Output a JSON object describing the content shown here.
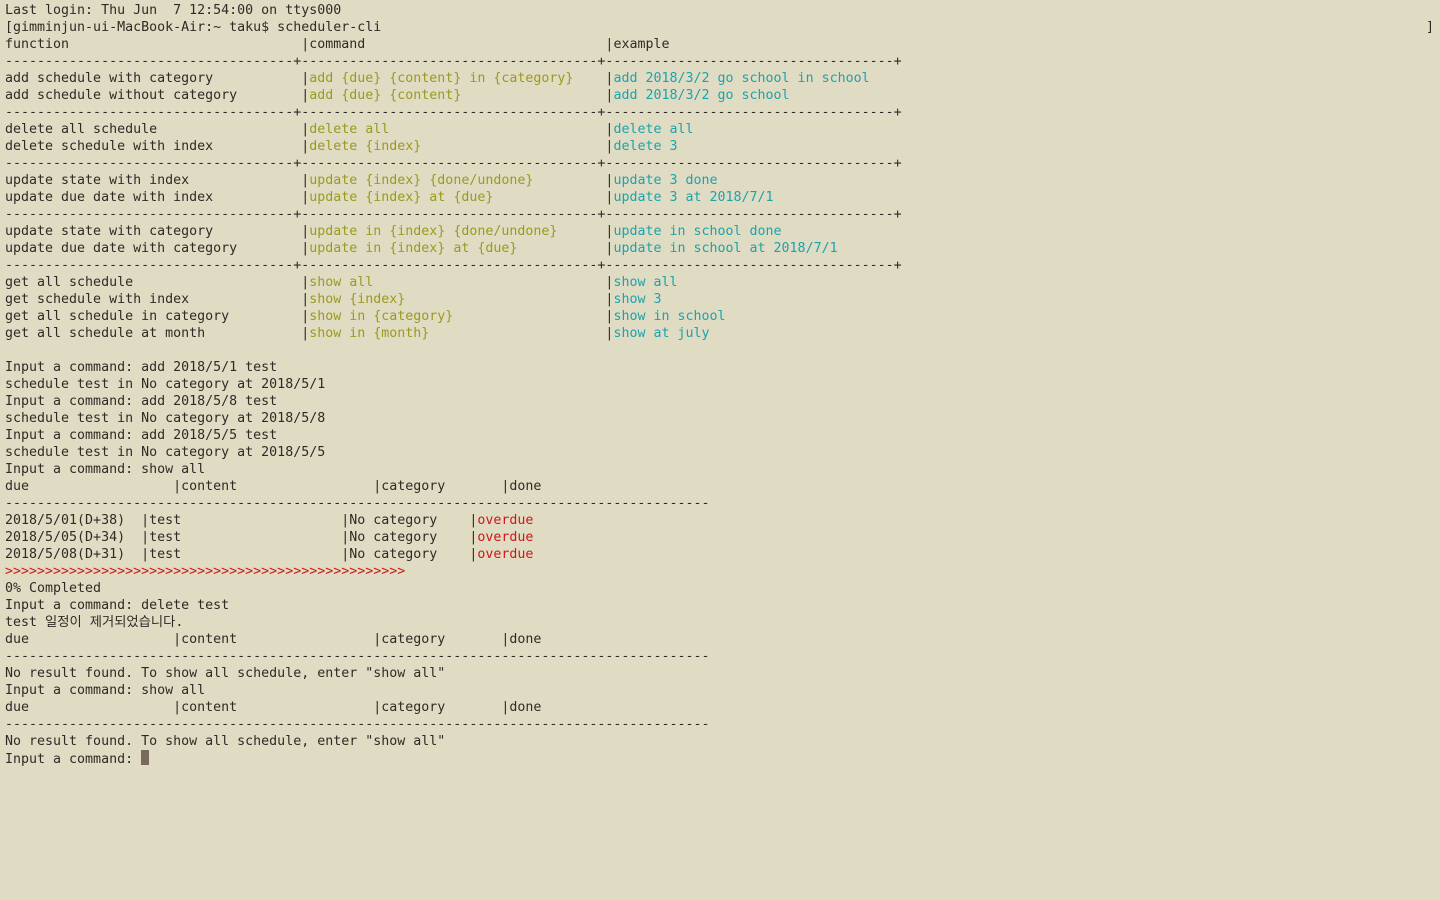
{
  "window": {
    "right_marker": "]",
    "cursor_icon": "block-cursor-icon"
  },
  "colors": {
    "background": "#e0dcc4",
    "text": "#2e2a26",
    "command": "#9b9a1c",
    "example": "#1aa3ad",
    "overdue": "#d01616",
    "cursor": "#7a6a5e"
  },
  "lines": [
    {
      "segs": [
        {
          "t": "Last login: Thu Jun  7 12:54:00 on ttys000",
          "c": "plain"
        }
      ]
    },
    {
      "segs": [
        {
          "t": "[gimminjun-ui-MacBook-Air:~ taku$ scheduler-cli",
          "c": "plain"
        }
      ]
    },
    {
      "segs": [
        {
          "t": "function                             |",
          "c": "fn"
        },
        {
          "t": "command",
          "c": "plain"
        },
        {
          "t": "                              |",
          "c": "pipe"
        },
        {
          "t": "example",
          "c": "plain"
        }
      ]
    },
    {
      "segs": [
        {
          "t": "------------------------------------+-------------------------------------+------------------------------------+",
          "c": "plain"
        }
      ]
    },
    {
      "segs": [
        {
          "t": "add schedule with category           |",
          "c": "fn"
        },
        {
          "t": "add {due} {content} in {category}",
          "c": "cmd"
        },
        {
          "t": "    |",
          "c": "pipe"
        },
        {
          "t": "add 2018/3/2 go school in school",
          "c": "ex"
        }
      ]
    },
    {
      "segs": [
        {
          "t": "add schedule without category        |",
          "c": "fn"
        },
        {
          "t": "add {due} {content}",
          "c": "cmd"
        },
        {
          "t": "                  |",
          "c": "pipe"
        },
        {
          "t": "add 2018/3/2 go school",
          "c": "ex"
        }
      ]
    },
    {
      "segs": [
        {
          "t": "------------------------------------+-------------------------------------+------------------------------------+",
          "c": "plain"
        }
      ]
    },
    {
      "segs": [
        {
          "t": "delete all schedule                  |",
          "c": "fn"
        },
        {
          "t": "delete all",
          "c": "cmd"
        },
        {
          "t": "                           |",
          "c": "pipe"
        },
        {
          "t": "delete all",
          "c": "ex"
        }
      ]
    },
    {
      "segs": [
        {
          "t": "delete schedule with index           |",
          "c": "fn"
        },
        {
          "t": "delete {index}",
          "c": "cmd"
        },
        {
          "t": "                       |",
          "c": "pipe"
        },
        {
          "t": "delete 3",
          "c": "ex"
        }
      ]
    },
    {
      "segs": [
        {
          "t": "------------------------------------+-------------------------------------+------------------------------------+",
          "c": "plain"
        }
      ]
    },
    {
      "segs": [
        {
          "t": "update state with index              |",
          "c": "fn"
        },
        {
          "t": "update {index} {done/undone}",
          "c": "cmd"
        },
        {
          "t": "         |",
          "c": "pipe"
        },
        {
          "t": "update 3 done",
          "c": "ex"
        }
      ]
    },
    {
      "segs": [
        {
          "t": "update due date with index           |",
          "c": "fn"
        },
        {
          "t": "update {index} at {due}",
          "c": "cmd"
        },
        {
          "t": "              |",
          "c": "pipe"
        },
        {
          "t": "update 3 at 2018/7/1",
          "c": "ex"
        }
      ]
    },
    {
      "segs": [
        {
          "t": "------------------------------------+-------------------------------------+------------------------------------+",
          "c": "plain"
        }
      ]
    },
    {
      "segs": [
        {
          "t": "update state with category           |",
          "c": "fn"
        },
        {
          "t": "update in {index} {done/undone}",
          "c": "cmd"
        },
        {
          "t": "      |",
          "c": "pipe"
        },
        {
          "t": "update in school done",
          "c": "ex"
        }
      ]
    },
    {
      "segs": [
        {
          "t": "update due date with category        |",
          "c": "fn"
        },
        {
          "t": "update in {index} at {due}",
          "c": "cmd"
        },
        {
          "t": "           |",
          "c": "pipe"
        },
        {
          "t": "update in school at 2018/7/1",
          "c": "ex"
        }
      ]
    },
    {
      "segs": [
        {
          "t": "------------------------------------+-------------------------------------+------------------------------------+",
          "c": "plain"
        }
      ]
    },
    {
      "segs": [
        {
          "t": "get all schedule                     |",
          "c": "fn"
        },
        {
          "t": "show all",
          "c": "cmd"
        },
        {
          "t": "                             |",
          "c": "pipe"
        },
        {
          "t": "show all",
          "c": "ex"
        }
      ]
    },
    {
      "segs": [
        {
          "t": "get schedule with index              |",
          "c": "fn"
        },
        {
          "t": "show {index}",
          "c": "cmd"
        },
        {
          "t": "                         |",
          "c": "pipe"
        },
        {
          "t": "show 3",
          "c": "ex"
        }
      ]
    },
    {
      "segs": [
        {
          "t": "get all schedule in category         |",
          "c": "fn"
        },
        {
          "t": "show in {category}",
          "c": "cmd"
        },
        {
          "t": "                   |",
          "c": "pipe"
        },
        {
          "t": "show in school",
          "c": "ex"
        }
      ]
    },
    {
      "segs": [
        {
          "t": "get all schedule at month            |",
          "c": "fn"
        },
        {
          "t": "show in {month}",
          "c": "cmd"
        },
        {
          "t": "                      |",
          "c": "pipe"
        },
        {
          "t": "show at july",
          "c": "ex"
        }
      ]
    },
    {
      "segs": [
        {
          "t": " ",
          "c": "plain"
        }
      ]
    },
    {
      "segs": [
        {
          "t": "Input a command: add 2018/5/1 test",
          "c": "plain"
        }
      ]
    },
    {
      "segs": [
        {
          "t": "schedule test in No category at 2018/5/1",
          "c": "plain"
        }
      ]
    },
    {
      "segs": [
        {
          "t": "Input a command: add 2018/5/8 test",
          "c": "plain"
        }
      ]
    },
    {
      "segs": [
        {
          "t": "schedule test in No category at 2018/5/8",
          "c": "plain"
        }
      ]
    },
    {
      "segs": [
        {
          "t": "Input a command: add 2018/5/5 test",
          "c": "plain"
        }
      ]
    },
    {
      "segs": [
        {
          "t": "schedule test in No category at 2018/5/5",
          "c": "plain"
        }
      ]
    },
    {
      "segs": [
        {
          "t": "Input a command: show all",
          "c": "plain"
        }
      ]
    },
    {
      "segs": [
        {
          "t": "due                  |content                 |category       |done",
          "c": "plain"
        }
      ]
    },
    {
      "segs": [
        {
          "t": "----------------------------------------------------------------------------------------",
          "c": "plain"
        }
      ]
    },
    {
      "segs": [
        {
          "t": "2018/5/01(D+38)  |test                    |No category    |",
          "c": "plain"
        },
        {
          "t": "overdue",
          "c": "red"
        }
      ]
    },
    {
      "segs": [
        {
          "t": "2018/5/05(D+34)  |test                    |No category    |",
          "c": "plain"
        },
        {
          "t": "overdue",
          "c": "red"
        }
      ]
    },
    {
      "segs": [
        {
          "t": "2018/5/08(D+31)  |test                    |No category    |",
          "c": "plain"
        },
        {
          "t": "overdue",
          "c": "red"
        }
      ]
    },
    {
      "segs": [
        {
          "t": ">>>>>>>>>>>>>>>>>>>>>>>>>>>>>>>>>>>>>>>>>>>>>>>>>>",
          "c": "red"
        }
      ]
    },
    {
      "segs": [
        {
          "t": "0% Completed",
          "c": "plain"
        }
      ]
    },
    {
      "segs": [
        {
          "t": "Input a command: delete test",
          "c": "plain"
        }
      ]
    },
    {
      "segs": [
        {
          "t": "test 일정이 제거되었습니다.",
          "c": "plain"
        }
      ]
    },
    {
      "segs": [
        {
          "t": "due                  |content                 |category       |done",
          "c": "plain"
        }
      ]
    },
    {
      "segs": [
        {
          "t": "----------------------------------------------------------------------------------------",
          "c": "plain"
        }
      ]
    },
    {
      "segs": [
        {
          "t": "No result found. To show all schedule, enter \"show all\"",
          "c": "plain"
        }
      ]
    },
    {
      "segs": [
        {
          "t": "Input a command: show all",
          "c": "plain"
        }
      ]
    },
    {
      "segs": [
        {
          "t": "due                  |content                 |category       |done",
          "c": "plain"
        }
      ]
    },
    {
      "segs": [
        {
          "t": "----------------------------------------------------------------------------------------",
          "c": "plain"
        }
      ]
    },
    {
      "segs": [
        {
          "t": "No result found. To show all schedule, enter \"show all\"",
          "c": "plain"
        }
      ]
    },
    {
      "segs": [
        {
          "t": "Input a command: ",
          "c": "plain"
        }
      ],
      "cursor": true
    }
  ]
}
